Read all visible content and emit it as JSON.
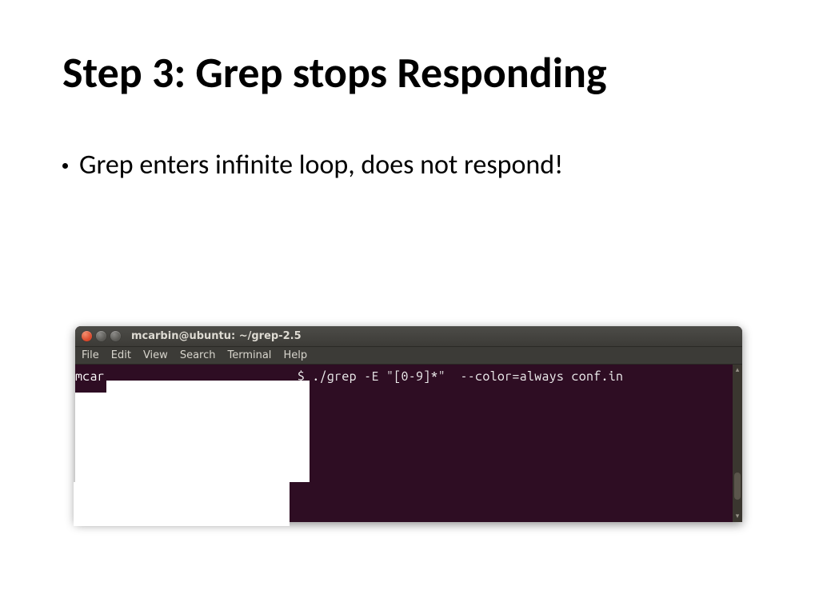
{
  "slide": {
    "title": "Step 3: Grep stops Responding",
    "bullet": "Grep enters infinite loop, does not respond!"
  },
  "terminal": {
    "title": "mcarbin@ubuntu: ~/grep-2.5",
    "menu": {
      "file": "File",
      "edit": "Edit",
      "view": "View",
      "search": "Search",
      "terminal": "Terminal",
      "help": "Help"
    },
    "prompt_user_fragment": "mcar",
    "prompt_symbol": "$",
    "command": "./grep -E \"[0-9]*\"  --color=always conf.in",
    "scroll_up": "▴",
    "scroll_down": "▾"
  }
}
